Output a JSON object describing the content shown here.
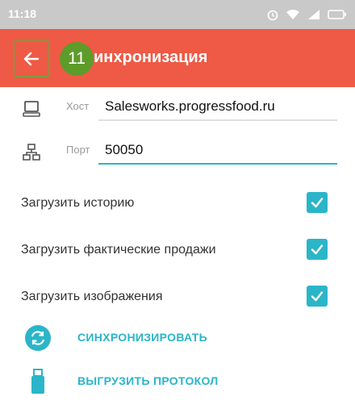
{
  "status_bar": {
    "time": "11:18"
  },
  "app_bar": {
    "step_number": "11",
    "title": "инхронизация"
  },
  "fields": {
    "host": {
      "label": "Хост",
      "value": "Salesworks.progressfood.ru"
    },
    "port": {
      "label": "Порт",
      "value": "50050"
    }
  },
  "options": [
    {
      "label": "Загрузить историю",
      "checked": true
    },
    {
      "label": "Загрузить фактические продажи",
      "checked": true
    },
    {
      "label": "Загрузить изображения",
      "checked": true
    }
  ],
  "actions": {
    "sync": {
      "label": "СИНХРОНИЗИРОВАТЬ",
      "icon": "sync-icon"
    },
    "export": {
      "label": "ВЫГРУЗИТЬ ПРОТОКОЛ",
      "icon": "usb-drive-icon"
    }
  },
  "colors": {
    "app_bar": "#ee5a45",
    "accent": "#2bb5c8",
    "step_badge": "#5d9c2a",
    "status_bar": "#c9c9c9"
  }
}
